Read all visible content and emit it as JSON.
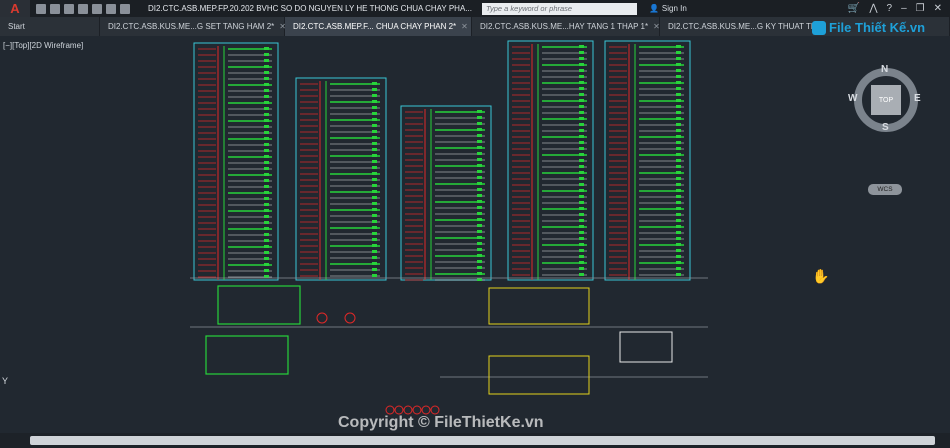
{
  "app": {
    "logo_letter": "A",
    "doc_title": "DI2.CTC.ASB.MEP.FP.20.202 BVHC SO DO NGUYEN LY HE THONG CHUA CHAY PHA...",
    "search_placeholder": "Type a keyword or phrase",
    "sign_in": "Sign In"
  },
  "tabs": [
    {
      "label": "Start",
      "closable": false,
      "active": false
    },
    {
      "label": "DI2.CTC.ASB.KUS.ME...G SET TANG HAM 2*",
      "closable": true,
      "active": false
    },
    {
      "label": "DI2.CTC.ASB.MEP.F... CHUA CHAY PHAN 2*",
      "closable": true,
      "active": true
    },
    {
      "label": "DI2.CTC.ASB.KUS.ME...HAY TANG 1 THAP 1*",
      "closable": true,
      "active": false
    },
    {
      "label": "DI2.CTC.ASB.KUS.ME...G KY THUAT THA",
      "closable": false,
      "active": false
    }
  ],
  "viewport": {
    "view_label": "[−][Top][2D Wireframe]",
    "compass": {
      "n": "N",
      "s": "S",
      "e": "E",
      "w": "W",
      "cube": "TOP"
    },
    "wcs": "WCS",
    "y_axis": "Y"
  },
  "watermark": "Copyright © FileThietKe.vn",
  "logo_text": "File Thiết Kế.vn",
  "colors": {
    "cyan": "#39c6d6",
    "red": "#e02828",
    "green": "#27d33a",
    "yellow": "#e3d21c",
    "white": "#e8e8e8"
  }
}
